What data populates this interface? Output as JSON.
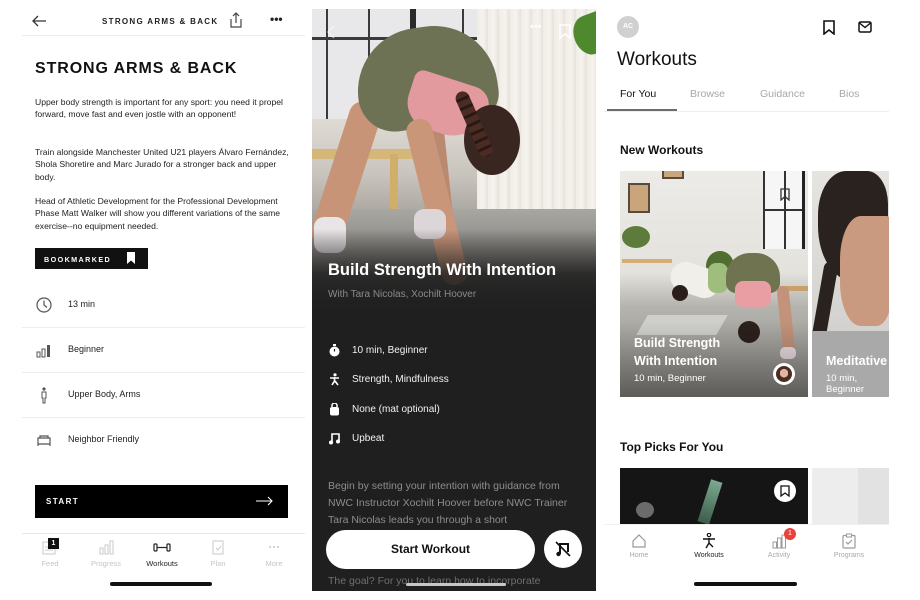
{
  "left_screen": {
    "header_title": "STRONG ARMS & BACK",
    "more_label": "•••",
    "title": "STRONG ARMS & BACK",
    "paragraphs": [
      "Upper body strength is important for any sport: you need it propel forward, move fast and even jostle with an opponent!",
      "Train alongside Manchester United U21 players Álvaro Fernández, Shola Shoretire and Marc Jurado for a stronger back and upper body.",
      "Head of Athletic Development for the Professional Development Phase Matt Walker will show you different variations of the same exercise--no equipment needed."
    ],
    "bookmark_label": "BOOKMARKED",
    "details": [
      {
        "icon": "clock-icon",
        "text": "13 min"
      },
      {
        "icon": "level-bars-icon",
        "text": "Beginner"
      },
      {
        "icon": "body-icon",
        "text": "Upper Body, Arms"
      },
      {
        "icon": "couch-icon",
        "text": "Neighbor Friendly"
      }
    ],
    "start_label": "START",
    "tabs": [
      {
        "label": "Feed",
        "icon": "feed-icon",
        "badge": "1",
        "active": false
      },
      {
        "label": "Progress",
        "icon": "progress-icon",
        "active": false
      },
      {
        "label": "Workouts",
        "icon": "dumbbell-icon",
        "active": true
      },
      {
        "label": "Plan",
        "icon": "clipboard-icon",
        "active": false
      },
      {
        "label": "More",
        "icon": "more-icon",
        "active": false
      }
    ]
  },
  "middle_screen": {
    "more_label": "•••",
    "title": "Build Strength With Intention",
    "subtitle": "With Tara Nicolas, Xochilt Hoover",
    "meta": [
      {
        "icon": "stopwatch-icon",
        "text": "10 min, Beginner"
      },
      {
        "icon": "activity-figure-icon",
        "text": "Strength, Mindfulness"
      },
      {
        "icon": "kettlebell-icon",
        "text": "None (mat optional)"
      },
      {
        "icon": "music-note-icon",
        "text": "Upbeat"
      }
    ],
    "description": "Begin by setting your intention with guidance from NWC Instructor Xochilt Hoover before NWC Trainer Tara Nicolas leads you through a short",
    "description_more": "The goal? For you to learn how to incorporate",
    "start_label": "Start Workout"
  },
  "right_screen": {
    "avatar_initials": "AC",
    "title": "Workouts",
    "tabs": [
      {
        "label": "For You",
        "active": true
      },
      {
        "label": "Browse",
        "active": false
      },
      {
        "label": "Guidance",
        "active": false
      },
      {
        "label": "Bios",
        "active": false
      }
    ],
    "new_workouts_heading": "New Workouts",
    "new_workouts": [
      {
        "title_line1": "Build Strength",
        "title_line2": "With Intention",
        "meta": "10 min, Beginner"
      },
      {
        "title_line1": "Meditative",
        "meta": "10 min, Beginner"
      }
    ],
    "top_picks_heading": "Top Picks For You",
    "bottom_tabs": [
      {
        "label": "Home",
        "icon": "home-icon",
        "active": false
      },
      {
        "label": "Workouts",
        "icon": "workout-figure-icon",
        "active": true
      },
      {
        "label": "Activity",
        "icon": "activity-bars-icon",
        "badge": "1",
        "active": false
      },
      {
        "label": "Programs",
        "icon": "programs-clipboard-icon",
        "active": false
      }
    ],
    "accent_badge_color": "#e8423b"
  }
}
